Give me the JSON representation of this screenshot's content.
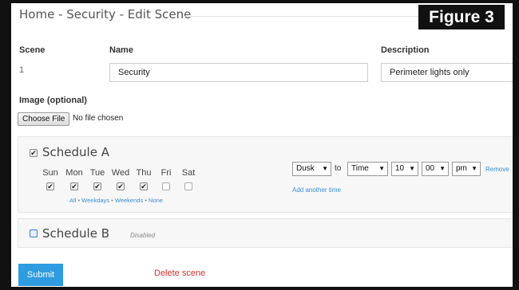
{
  "breadcrumb": "Home - Security - Edit Scene",
  "figure_label": "Figure 3",
  "scene": {
    "label": "Scene",
    "value": "1"
  },
  "name": {
    "label": "Name",
    "value": "Security"
  },
  "description": {
    "label": "Description",
    "value": "Perimeter lights only"
  },
  "image": {
    "label": "Image (optional)",
    "button": "Choose File",
    "status": "No file chosen"
  },
  "schedule_a": {
    "title": "Schedule A",
    "enabled": true,
    "days": [
      {
        "label": "Sun",
        "checked": true
      },
      {
        "label": "Mon",
        "checked": true
      },
      {
        "label": "Tue",
        "checked": true
      },
      {
        "label": "Wed",
        "checked": true
      },
      {
        "label": "Thu",
        "checked": true
      },
      {
        "label": "Fri",
        "checked": false
      },
      {
        "label": "Sat",
        "checked": false
      }
    ],
    "quick_links": {
      "all": "All",
      "weekdays": "Weekdays",
      "weekends": "Weekends",
      "none": "None",
      "separator": "•"
    },
    "time": {
      "start": "Dusk",
      "to": "to",
      "end_type": "Time",
      "hour": "10",
      "minute": "00",
      "ampm": "pm"
    },
    "remove": "Remove",
    "add_time": "Add another time"
  },
  "schedule_b": {
    "title": "Schedule B",
    "status": "Disabled",
    "enabled": false
  },
  "submit": "Submit",
  "delete": "Delete scene",
  "colors": {
    "accent": "#2f9be0",
    "link": "#3a8ed8",
    "danger": "#d93030"
  },
  "icons": {
    "checkbox_checked": "✔",
    "select_arrow": "▼"
  }
}
